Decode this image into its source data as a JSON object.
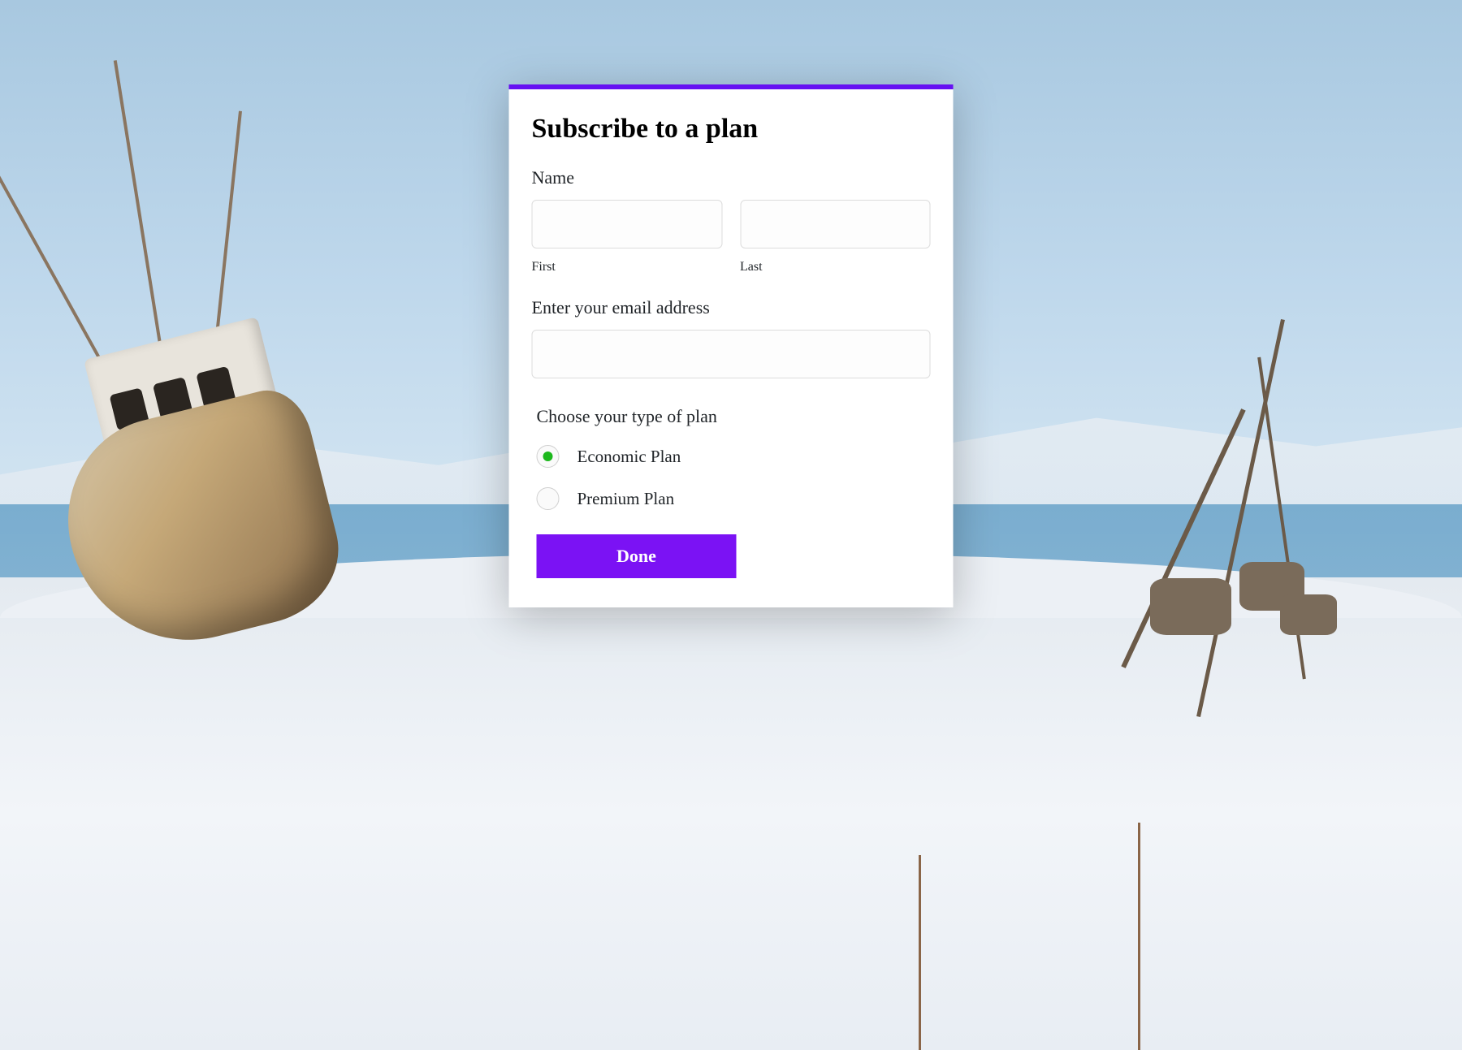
{
  "form": {
    "title": "Subscribe to a plan",
    "name": {
      "label": "Name",
      "first": {
        "sublabel": "First",
        "value": ""
      },
      "last": {
        "sublabel": "Last",
        "value": ""
      }
    },
    "email": {
      "label": "Enter your email address",
      "value": ""
    },
    "plan": {
      "label": "Choose your type of plan",
      "options": [
        {
          "label": "Economic Plan",
          "checked": true
        },
        {
          "label": "Premium Plan",
          "checked": false
        }
      ]
    },
    "submit_label": "Done"
  },
  "colors": {
    "accent": "#6610f2",
    "button": "#7b12f4",
    "radio_checked": "#1db81d"
  }
}
